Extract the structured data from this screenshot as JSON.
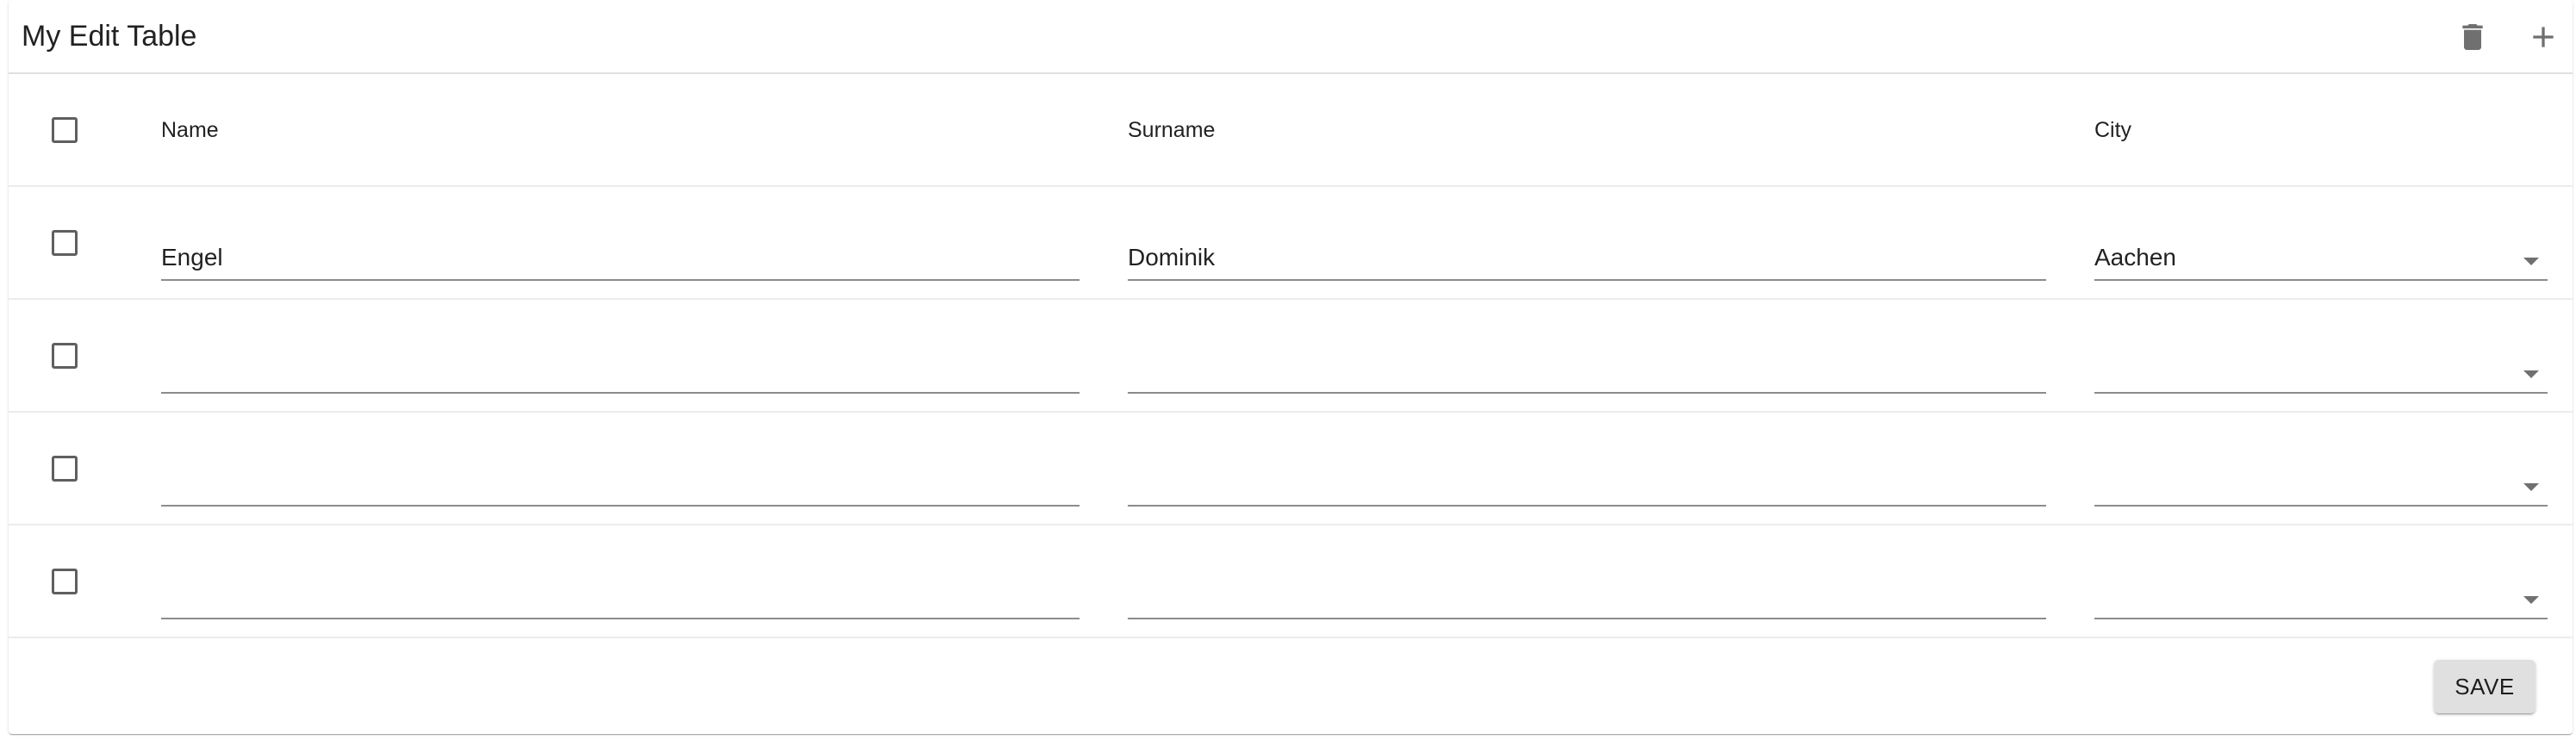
{
  "table": {
    "title": "My Edit Table",
    "columns": [
      "Name",
      "Surname",
      "City"
    ],
    "rows": [
      {
        "name": "Engel",
        "surname": "Dominik",
        "city": "Aachen"
      },
      {
        "name": "",
        "surname": "",
        "city": ""
      },
      {
        "name": "",
        "surname": "",
        "city": ""
      },
      {
        "name": "",
        "surname": "",
        "city": ""
      }
    ],
    "save_label": "SAVE"
  },
  "icons": {
    "delete": "trash-icon",
    "add": "plus-icon"
  },
  "colors": {
    "icon": "#707070",
    "button_bg": "#e0e0e0",
    "underline": "#8c8c8c"
  }
}
